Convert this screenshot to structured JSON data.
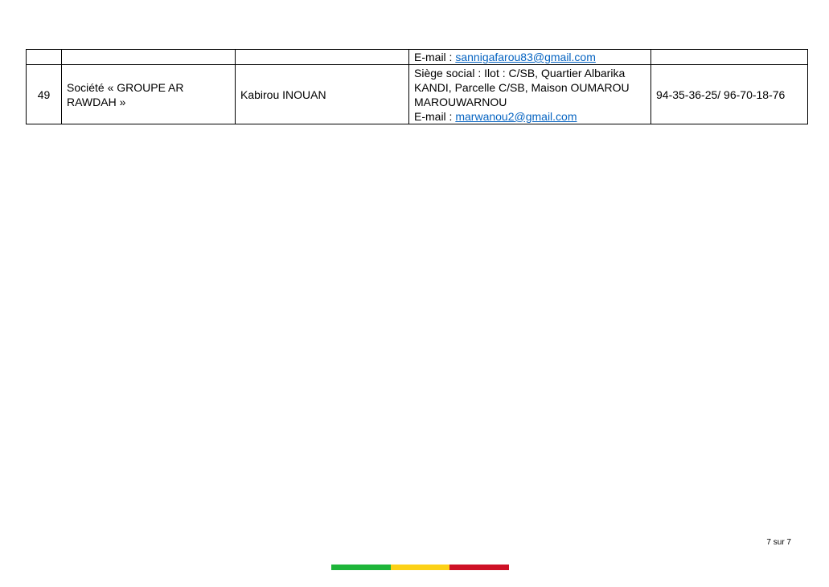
{
  "table": {
    "rows": [
      {
        "number": "",
        "company": "",
        "manager": "",
        "address_lines": [],
        "email_label": "E-mail : ",
        "email": "sannigafarou83@gmail.com",
        "phone": ""
      },
      {
        "number": "49",
        "company": "Société « GROUPE AR RAWDAH »",
        "manager": "Kabirou INOUAN",
        "address_lines": [
          "Siège social : Ilot : C/SB, Quartier Albarika KANDI, Parcelle C/SB, Maison OUMAROU MAROUWARNOU"
        ],
        "email_label": "E-mail : ",
        "email": "marwanou2@gmail.com",
        "phone": "94-35-36-25/ 96-70-18-76"
      }
    ]
  },
  "footer": {
    "page_number": "7 sur 7",
    "flag_colors": [
      "#1eb53a",
      "#fcd116",
      "#ce1126"
    ]
  }
}
